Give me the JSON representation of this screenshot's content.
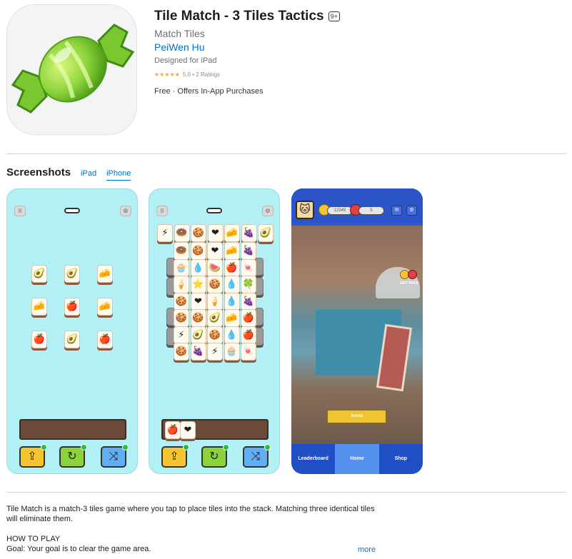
{
  "app": {
    "title": "Tile Match - 3 Tiles Tactics",
    "age_rating": "9+",
    "subtitle": "Match Tiles",
    "developer": "PeiWen Hu",
    "designed_for": "Designed for iPad",
    "stars": "★★★★★",
    "rating_text": "5.0 • 2 Ratings",
    "price_text": "Free · Offers In-App Purchases",
    "icon": "green-candy-icon",
    "colors": {
      "link": "#0070c9",
      "star": "#f5a623",
      "candy": "#8cd33b"
    }
  },
  "screenshots": {
    "title": "Screenshots",
    "tabs": [
      {
        "label": "iPad",
        "active": false
      },
      {
        "label": "iPhone",
        "active": true
      }
    ],
    "shot1": {
      "pause_icon": "II",
      "settings_icon": "⚙",
      "tiles": [
        "🥑",
        "🥑",
        "🧀",
        "🧀",
        "🍎",
        "🧀",
        "🍎",
        "🥑",
        "🍎"
      ],
      "powerups": [
        "⇪",
        "↻",
        "⤨"
      ]
    },
    "shot2": {
      "pause_icon": "II",
      "settings_icon": "⚙",
      "top_row": [
        "⚡",
        "🍩",
        "🍪",
        "❤",
        "🧀",
        "🍇",
        "🥑"
      ],
      "grid": [
        [
          "🍩",
          "🍪",
          "❤",
          "🧀",
          "🍇"
        ],
        [
          "🧁",
          "💧",
          "🍉",
          "🍎",
          "🍬"
        ],
        [
          "🍦",
          "⭐",
          "🍪",
          "💧",
          "🍀"
        ],
        [
          "🍪",
          "❤",
          "🍦",
          "💧",
          "🍇"
        ],
        [
          "🍪",
          "🍪",
          "🥑",
          "🧀",
          "🍎"
        ],
        [
          "⚡",
          "🥑",
          "🍪",
          "💧",
          "🍎"
        ],
        [
          "🍪",
          "🍇",
          "⚡",
          "🧁",
          "🍬"
        ]
      ],
      "tray_tiles": [
        "🍎",
        "❤"
      ],
      "powerups": [
        "⇪",
        "↻",
        "⤨"
      ]
    },
    "shot3": {
      "avatar": "🐱",
      "coin_text": "12345",
      "energy_text": "5",
      "mail_icon": "✉",
      "settings_icon": "⚙",
      "gift_label": "GIFT PACK",
      "arena_label": "Arena",
      "nav": [
        "Leaderboard",
        "Home",
        "Shop"
      ]
    }
  },
  "description": {
    "paragraph1": "Tile Match is a match-3 tiles game where you tap to place tiles into the stack. Matching three identical tiles will eliminate them.",
    "heading": "HOW TO PLAY",
    "goal": "Goal: Your goal is to clear the game area.",
    "more_label": "more"
  }
}
